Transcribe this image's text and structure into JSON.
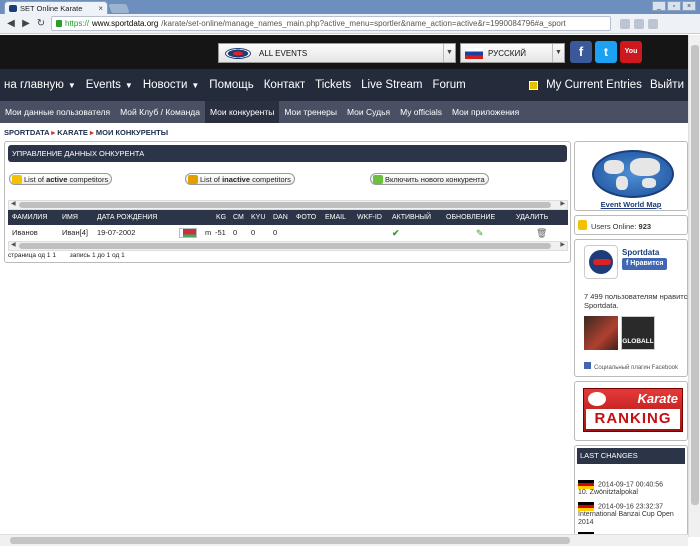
{
  "browser": {
    "tab_title": "SET Online Karate",
    "tab_close": "×",
    "window_buttons": [
      "_",
      "▫",
      "×"
    ],
    "url_prefix": "https://",
    "url_host": "www.sportdata.org",
    "url_path": "/karate/set-online/manage_names_main.php?active_menu=sportler&name_action=active&r=1990084796#a_sport"
  },
  "header": {
    "event_select": "ALL EVENTS",
    "language_select": "РУССКИЙ"
  },
  "social": [
    {
      "name": "facebook",
      "glyph": "f",
      "color": "#3b5998"
    },
    {
      "name": "twitter",
      "glyph": "t",
      "color": "#1da1f2"
    },
    {
      "name": "youtube",
      "glyph": "You",
      "color": "#cc181e"
    }
  ],
  "menu": {
    "items": [
      {
        "label": "на главную",
        "dropdown": true
      },
      {
        "label": "Events",
        "dropdown": true
      },
      {
        "label": "Новости",
        "dropdown": true
      },
      {
        "label": "Помощь",
        "dropdown": false
      },
      {
        "label": "Контакт",
        "dropdown": false
      },
      {
        "label": "Tickets",
        "dropdown": false
      },
      {
        "label": "Live Stream",
        "dropdown": false
      },
      {
        "label": "Forum",
        "dropdown": false
      }
    ],
    "current_entries": "My Current Entries",
    "logout": "Выйти"
  },
  "submenu": [
    {
      "label": "Мои данные пользователя",
      "active": false
    },
    {
      "label": "Мой Клуб / Команда",
      "active": false
    },
    {
      "label": "Мои конкуренты",
      "active": true
    },
    {
      "label": "Мои тренеры",
      "active": false
    },
    {
      "label": "Мои Судья",
      "active": false
    },
    {
      "label": "My officials",
      "active": false
    },
    {
      "label": "Мои приложения",
      "active": false
    }
  ],
  "breadcrumb": {
    "a": "SPORTDATA",
    "b": "KARATE",
    "c": "МОИ КОНКУРЕНТЫ"
  },
  "panel": {
    "title": "УПРАВЛЕНИЕ ДАННЫХ ОНКУРЕНТА",
    "btn_active_pre": "List of ",
    "btn_active_bold": "active",
    "btn_active_post": " competitors",
    "btn_inactive_pre": "List of ",
    "btn_inactive_bold": "inactive",
    "btn_inactive_post": " competitors",
    "btn_add": "Включить нового конкурента"
  },
  "table": {
    "headers": [
      "ФАМИЛИЯ",
      "ИМЯ",
      "ДАТА РОЖДЕНИЯ",
      "KG",
      "CM",
      "KYU",
      "DAN",
      "ФОТО",
      "EMAIL",
      "WKF-ID",
      "АКТИВНЫЙ",
      "ОБНОВЛЕНИЕ",
      "УДАЛИТЬ"
    ],
    "rows": [
      {
        "last": "Иванов",
        "first": "Иван[4]",
        "dob": "19-07-2002",
        "gender": "m",
        "kg": "-51",
        "cm": "0",
        "kyu": "0",
        "dan": "0"
      }
    ],
    "footer_pages": "страница од 1 1",
    "footer_records": "запись 1 до 1 од 1"
  },
  "sidebar": {
    "world_map_label": "Event World Map",
    "users_online_label": "Users Online:",
    "users_online_count": "923",
    "fb_page_name": "Sportdata",
    "fb_like": "Нравится",
    "fb_fans_count": "7 499",
    "fb_fans_text": " пользователям нравится",
    "fb_fans_page": "Sportdata.",
    "fb_plugin": "Социальный плагин Facebook",
    "photo_label_2": "GLOBALL",
    "ranking_top": "Karate",
    "ranking_bottom": "RANKING",
    "last_changes_title": "LAST CHANGES",
    "last_changes": [
      {
        "date": "2014-09-17 00:40:56",
        "event": "10. Zwönitztalpokal"
      },
      {
        "date": "2014-09-16 23:32:37",
        "event": "International Banzai Cup Open 2014"
      }
    ]
  }
}
